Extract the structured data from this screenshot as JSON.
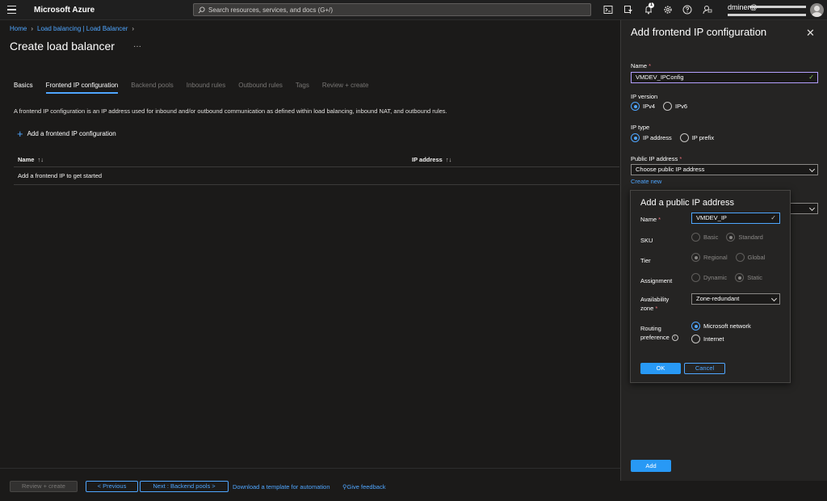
{
  "topbar": {
    "brand": "Microsoft Azure",
    "search_placeholder": "Search resources, services, and docs (G+/)",
    "notification_count": "1",
    "user": "dminer@"
  },
  "breadcrumb": [
    "Home",
    "Load balancing | Load Balancer"
  ],
  "page": {
    "title": "Create load balancer",
    "more": "···"
  },
  "tabs": [
    {
      "label": "Basics",
      "state": "enabled"
    },
    {
      "label": "Frontend IP configuration",
      "state": "active"
    },
    {
      "label": "Backend pools",
      "state": "disabled"
    },
    {
      "label": "Inbound rules",
      "state": "disabled"
    },
    {
      "label": "Outbound rules",
      "state": "disabled"
    },
    {
      "label": "Tags",
      "state": "disabled"
    },
    {
      "label": "Review + create",
      "state": "disabled"
    }
  ],
  "description": "A frontend IP configuration is an IP address used for inbound and/or outbound communication as defined within load balancing, inbound NAT, and outbound rules.",
  "add_frontend_label": "Add a frontend IP configuration",
  "table": {
    "columns": [
      "Name",
      "IP address"
    ],
    "empty_row": "Add a frontend IP to get started"
  },
  "footer": {
    "review_create": "Review + create",
    "previous": "< Previous",
    "next": "Next : Backend pools >",
    "download": "Download a template for automation",
    "feedback": "Give feedback"
  },
  "panel": {
    "title": "Add frontend IP configuration",
    "name_label": "Name",
    "name_value": "VMDEV_IPConfig",
    "ip_version_label": "IP version",
    "ip_version_options": [
      "IPv4",
      "IPv6"
    ],
    "ip_type_label": "IP type",
    "ip_type_options": [
      "IP address",
      "IP prefix"
    ],
    "public_ip_label": "Public IP address",
    "public_ip_placeholder": "Choose public IP address",
    "create_new": "Create new",
    "add_button": "Add"
  },
  "popup": {
    "title": "Add a public IP address",
    "name_label": "Name",
    "name_value": "VMDEV_IP",
    "sku_label": "SKU",
    "sku_options": [
      "Basic",
      "Standard"
    ],
    "tier_label": "Tier",
    "tier_options": [
      "Regional",
      "Global"
    ],
    "assignment_label": "Assignment",
    "assignment_options": [
      "Dynamic",
      "Static"
    ],
    "az_label_1": "Availability",
    "az_label_2": "zone",
    "az_value": "Zone-redundant",
    "routing_label_1": "Routing",
    "routing_label_2": "preference",
    "routing_options": [
      "Microsoft network",
      "Internet"
    ],
    "ok": "OK",
    "cancel": "Cancel"
  },
  "colors": {
    "accent": "#4fa6ff",
    "primary_button": "#2899f5",
    "required": "#f1707b",
    "valid_check": "#8cc75e"
  }
}
